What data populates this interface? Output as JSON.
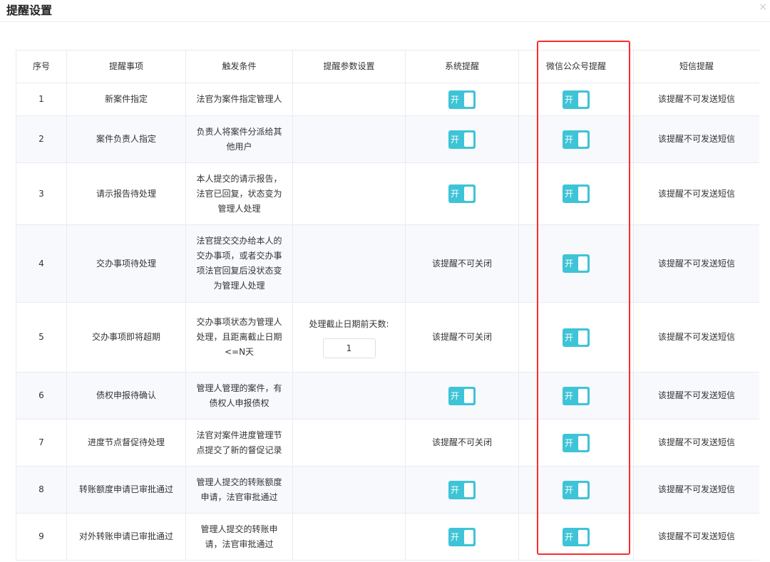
{
  "dialog": {
    "title": "提醒设置",
    "close_glyph": "×"
  },
  "table": {
    "headers": [
      "序号",
      "提醒事项",
      "触发条件",
      "提醒参数设置",
      "系统提醒",
      "微信公众号提醒",
      "短信提醒"
    ],
    "rows": [
      {
        "index": "1",
        "item": "新案件指定",
        "condition": "法官为案件指定管理人",
        "param_label": "",
        "param_value": "",
        "system": "开",
        "wechat": "开",
        "sms": "该提醒不可发送短信"
      },
      {
        "index": "2",
        "item": "案件负责人指定",
        "condition": "负责人将案件分派给其他用户",
        "param_label": "",
        "param_value": "",
        "system": "开",
        "wechat": "开",
        "sms": "该提醒不可发送短信"
      },
      {
        "index": "3",
        "item": "请示报告待处理",
        "condition": "本人提交的请示报告，法官已回复，状态变为管理人处理",
        "param_label": "",
        "param_value": "",
        "system": "开",
        "wechat": "开",
        "sms": "该提醒不可发送短信"
      },
      {
        "index": "4",
        "item": "交办事项待处理",
        "condition": "法官提交交办给本人的交办事项，或者交办事项法官回复后没状态变为管理人处理",
        "param_label": "",
        "param_value": "",
        "system": "该提醒不可关闭",
        "wechat": "开",
        "sms": "该提醒不可发送短信"
      },
      {
        "index": "5",
        "item": "交办事项即将超期",
        "condition": "交办事项状态为管理人处理，且距离截止日期<=N天",
        "param_label": "处理截止日期前天数:",
        "param_value": "1",
        "system": "该提醒不可关闭",
        "wechat": "开",
        "sms": "该提醒不可发送短信"
      },
      {
        "index": "6",
        "item": "债权申报待确认",
        "condition": "管理人管理的案件，有债权人申报债权",
        "param_label": "",
        "param_value": "",
        "system": "开",
        "wechat": "开",
        "sms": "该提醒不可发送短信"
      },
      {
        "index": "7",
        "item": "进度节点督促待处理",
        "condition": "法官对案件进度管理节点提交了新的督促记录",
        "param_label": "",
        "param_value": "",
        "system": "该提醒不可关闭",
        "wechat": "开",
        "sms": "该提醒不可发送短信"
      },
      {
        "index": "8",
        "item": "转账额度申请已审批通过",
        "condition": "管理人提交的转账额度申请，法官审批通过",
        "param_label": "",
        "param_value": "",
        "system": "开",
        "wechat": "开",
        "sms": "该提醒不可发送短信"
      },
      {
        "index": "9",
        "item": "对外转账申请已审批通过",
        "condition": "管理人提交的转账申请，法官审批通过",
        "param_label": "",
        "param_value": "",
        "system": "开",
        "wechat": "开",
        "sms": "该提醒不可发送短信"
      }
    ]
  },
  "colors": {
    "switch_on": "#3ec4d6",
    "highlight": "#ff2a2a"
  }
}
